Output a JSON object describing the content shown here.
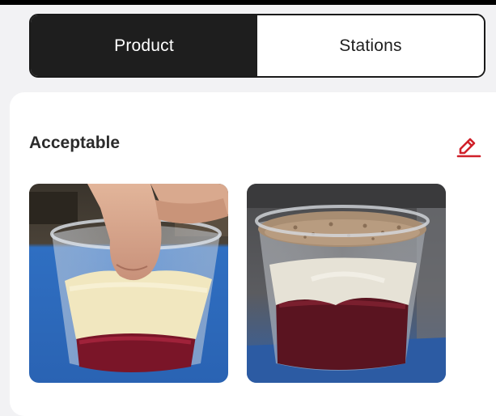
{
  "tabs": [
    {
      "label": "Product",
      "active": true
    },
    {
      "label": "Stations",
      "active": false
    }
  ],
  "section": {
    "title": "Acceptable",
    "edit_icon": "pencil-edit-icon"
  },
  "photos": [
    {
      "name": "hand-holding-parfait-cup"
    },
    {
      "name": "parfait-cup-with-crumb-topping"
    }
  ],
  "colors": {
    "tab_active_bg": "#1e1e1e",
    "tab_active_text": "#ffffff",
    "accent": "#d0202a",
    "page_bg": "#f2f2f4"
  }
}
